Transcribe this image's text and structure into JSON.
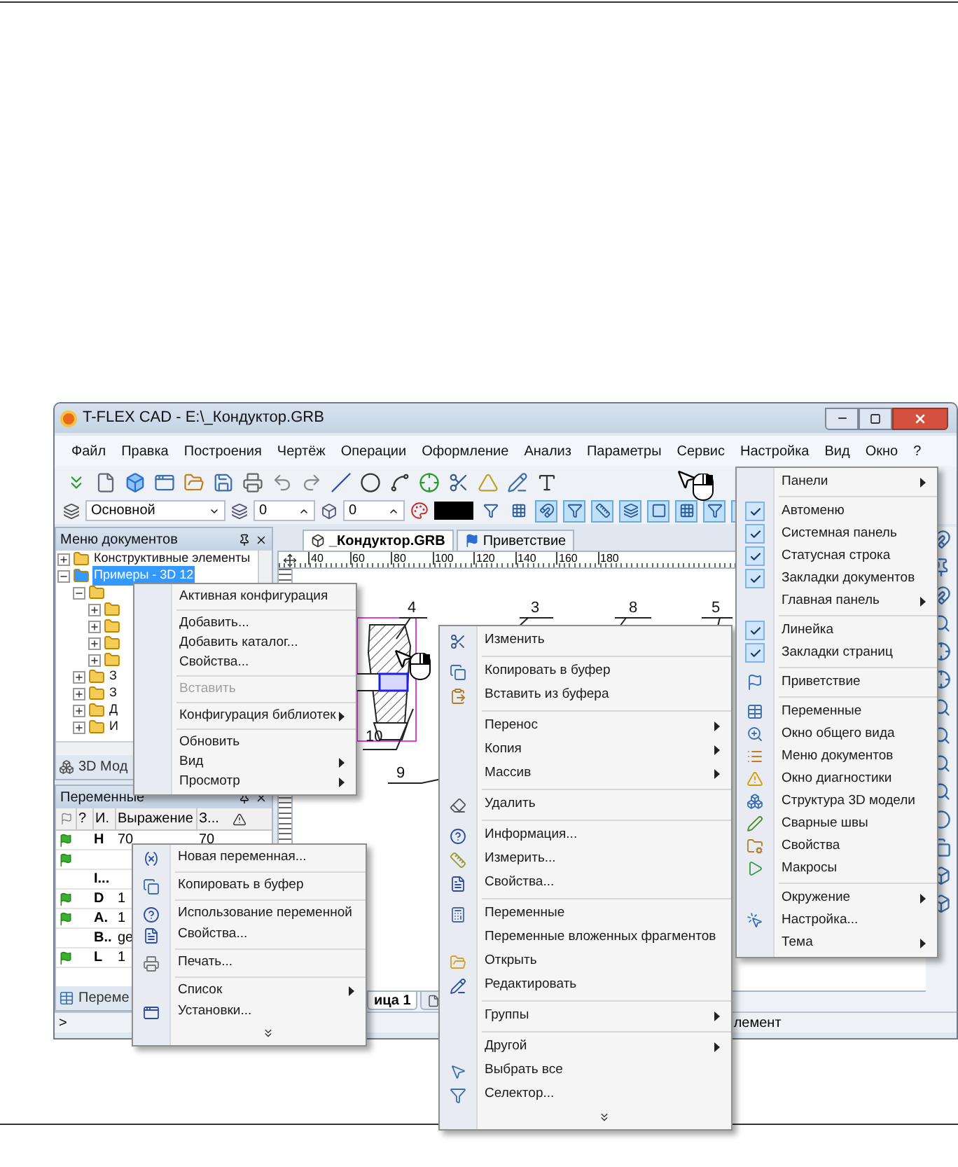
{
  "window": {
    "title": "T-FLEX CAD - E:\\_Кондуктор.GRB"
  },
  "menu_bar": [
    "Файл",
    "Правка",
    "Построения",
    "Чертёж",
    "Операции",
    "Оформление",
    "Анализ",
    "Параметры",
    "Сервис",
    "Настройка",
    "Вид",
    "Окно",
    "?"
  ],
  "toolbar": {
    "layer": "Основной",
    "spin_1": "0",
    "spin_2": "0"
  },
  "documents_panel": {
    "title": "Меню документов",
    "tree": [
      {
        "label": "Конструктивные элементы",
        "expanded": false,
        "selected": false
      },
      {
        "label": "Примеры - 3D 12",
        "expanded": true,
        "selected": true,
        "children": [
          {
            "expanded": true,
            "selected": false,
            "children": [
              {
                "expanded": false,
                "selected": false
              },
              {
                "expanded": false,
                "selected": false
              },
              {
                "expanded": false,
                "selected": false
              },
              {
                "expanded": false,
                "selected": false
              }
            ]
          },
          {
            "label": "З",
            "expanded": false,
            "selected": false
          },
          {
            "label": "З",
            "expanded": false,
            "selected": false
          },
          {
            "label": "Д",
            "expanded": false,
            "selected": false
          },
          {
            "label": "И",
            "expanded": false,
            "selected": false
          }
        ]
      }
    ],
    "tab": "3D Мод"
  },
  "variables_panel": {
    "title": "Переменные",
    "columns": [
      "?",
      "И.",
      "Выражение",
      "З..."
    ],
    "rows": [
      {
        "flag": true,
        "name": "H",
        "expression": "70",
        "value": "70"
      },
      {
        "flag": true
      },
      {
        "flag": false,
        "name": "I..."
      },
      {
        "flag": true,
        "name": "D",
        "expression": "1"
      },
      {
        "flag": true,
        "name": "A.",
        "expression": "1"
      },
      {
        "flag": false,
        "name": "B..",
        "expression": "ge"
      },
      {
        "flag": true,
        "name": "L",
        "expression": "1"
      }
    ],
    "tab": "Переме"
  },
  "drawing": {
    "doc_tabs": [
      {
        "label": "_Кондуктор.GRB",
        "selected": true
      },
      {
        "label": "Приветствие",
        "selected": false
      }
    ],
    "ruler": [
      "40",
      "60",
      "80",
      "100",
      "120",
      "140",
      "160",
      "180"
    ],
    "callouts": [
      "4",
      "3",
      "8",
      "5",
      "10",
      "9"
    ],
    "page_tabs": [
      {
        "label": "ица 1",
        "selected": true
      },
      {
        "selected": false
      }
    ]
  },
  "status_bar": {
    "prompt": ">",
    "message": "лемент"
  },
  "documents_menu": {
    "groups": [
      [
        {
          "label": "Активная конфигурация",
          "submenu": false,
          "disabled": false
        }
      ],
      [
        {
          "label": "Добавить...",
          "submenu": false,
          "disabled": false
        },
        {
          "label": "Добавить каталог...",
          "submenu": false,
          "disabled": false
        },
        {
          "label": "Свойства...",
          "submenu": false,
          "disabled": false
        }
      ],
      [
        {
          "label": "Вставить",
          "submenu": false,
          "disabled": true
        }
      ],
      [
        {
          "label": "Конфигурация библиотек",
          "submenu": true,
          "disabled": false
        }
      ],
      [
        {
          "label": "Обновить",
          "submenu": false,
          "disabled": false
        },
        {
          "label": "Вид",
          "submenu": true,
          "disabled": false
        },
        {
          "label": "Просмотр",
          "submenu": true,
          "disabled": false
        }
      ]
    ]
  },
  "drawing_menu": {
    "more": true,
    "groups": [
      [
        {
          "label": "Изменить",
          "submenu": false
        }
      ],
      [
        {
          "label": "Копировать в буфер",
          "submenu": false
        },
        {
          "label": "Вставить из буфера",
          "submenu": false
        }
      ],
      [
        {
          "label": "Перенос",
          "submenu": true
        },
        {
          "label": "Копия",
          "submenu": true
        },
        {
          "label": "Массив",
          "submenu": true
        }
      ],
      [
        {
          "label": "Удалить",
          "submenu": false
        }
      ],
      [
        {
          "label": "Информация...",
          "submenu": false
        },
        {
          "label": "Измерить...",
          "submenu": false
        },
        {
          "label": "Свойства...",
          "submenu": false
        }
      ],
      [
        {
          "label": "Переменные",
          "submenu": false
        },
        {
          "label": "Переменные вложенных фрагментов",
          "submenu": false
        },
        {
          "label": "Открыть",
          "submenu": false
        },
        {
          "label": "Редактировать",
          "submenu": false
        }
      ],
      [
        {
          "label": "Группы",
          "submenu": true
        }
      ],
      [
        {
          "label": "Другой",
          "submenu": true
        },
        {
          "label": "Выбрать все",
          "submenu": false
        },
        {
          "label": "Селектор...",
          "submenu": false
        }
      ]
    ]
  },
  "view_menu": {
    "groups": [
      [
        {
          "label": "Панели",
          "submenu": true,
          "checked": false
        }
      ],
      [
        {
          "label": "Автоменю",
          "submenu": false,
          "checked": true
        },
        {
          "label": "Системная панель",
          "submenu": false,
          "checked": true
        },
        {
          "label": "Статусная строка",
          "submenu": false,
          "checked": true
        },
        {
          "label": "Закладки документов",
          "submenu": false,
          "checked": true
        },
        {
          "label": "Главная панель",
          "submenu": true,
          "checked": false
        }
      ],
      [
        {
          "label": "Линейка",
          "submenu": false,
          "checked": true
        },
        {
          "label": "Закладки страниц",
          "submenu": false,
          "checked": true
        }
      ],
      [
        {
          "label": "Приветствие",
          "submenu": false,
          "checked": false
        }
      ],
      [
        {
          "label": "Переменные",
          "submenu": false,
          "checked": false
        },
        {
          "label": "Окно общего вида",
          "submenu": false,
          "checked": false
        },
        {
          "label": "Меню документов",
          "submenu": false,
          "checked": false
        },
        {
          "label": "Окно диагностики",
          "submenu": false,
          "checked": false
        },
        {
          "label": "Структура 3D модели",
          "submenu": false,
          "checked": false
        },
        {
          "label": "Сварные швы",
          "submenu": false,
          "checked": false
        },
        {
          "label": "Свойства",
          "submenu": false,
          "checked": false
        },
        {
          "label": "Макросы",
          "submenu": false,
          "checked": false
        }
      ],
      [
        {
          "label": "Окружение",
          "submenu": true,
          "checked": false
        },
        {
          "label": "Настройка...",
          "submenu": false,
          "checked": false
        },
        {
          "label": "Тема",
          "submenu": true,
          "checked": false
        }
      ]
    ]
  },
  "variables_menu": {
    "more": true,
    "groups": [
      [
        {
          "label": "Новая переменная...",
          "submenu": false
        }
      ],
      [
        {
          "label": "Копировать в буфер",
          "submenu": false
        }
      ],
      [
        {
          "label": "Использование переменной",
          "submenu": false
        },
        {
          "label": "Свойства...",
          "submenu": false
        }
      ],
      [
        {
          "label": "Печать...",
          "submenu": false
        }
      ],
      [
        {
          "label": "Список",
          "submenu": true
        },
        {
          "label": "Установки...",
          "submenu": false
        }
      ]
    ]
  }
}
